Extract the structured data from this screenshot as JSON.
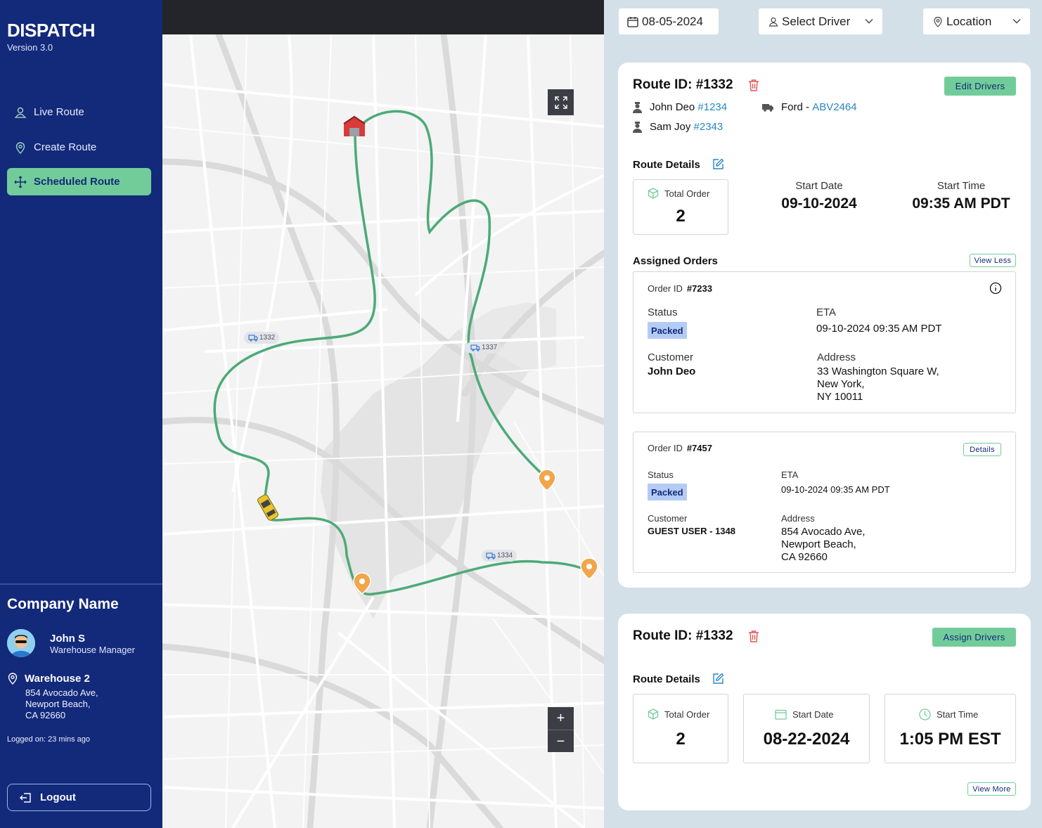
{
  "app": {
    "brand": "DISPATCH",
    "version": "Version 3.0"
  },
  "sidebar": {
    "items": [
      {
        "label": "Live Route",
        "icon": "person-pin-icon",
        "active": false
      },
      {
        "label": "Create Route",
        "icon": "location-pin-icon",
        "active": false
      },
      {
        "label": "Scheduled Route",
        "icon": "move-arrows-icon",
        "active": true
      }
    ],
    "company": "Company Name",
    "user": {
      "name": "John S",
      "role": "Warehouse  Manager"
    },
    "warehouse": {
      "name": "Warehouse 2",
      "address": [
        "854 Avocado Ave,",
        "Newport Beach,",
        "CA 92660"
      ]
    },
    "logged_on": "Logged on:  23 mins ago",
    "logout_label": "Logout"
  },
  "map": {
    "route_tags": [
      "1332",
      "1337",
      "1334"
    ],
    "zoom_in": "+",
    "zoom_out": "−"
  },
  "filters": {
    "date": "08-05-2024",
    "driver": "Select Driver",
    "location": "Location"
  },
  "routes": [
    {
      "route_id": "Route ID: #1332",
      "action_label": "Edit Drivers",
      "drivers": [
        {
          "name": "John Deo",
          "id": "#1234"
        },
        {
          "name": "Sam Joy",
          "id": "#2343"
        }
      ],
      "vehicle": {
        "make": "Ford - ",
        "plate": "ABV2464"
      },
      "details_title": "Route Details",
      "total_order_label": "Total Order",
      "total_order": "2",
      "start_date_label": "Start Date",
      "start_date": "09-10-2024",
      "start_time_label": "Start Time",
      "start_time": "09:35 AM PDT",
      "assigned_title": "Assigned Orders",
      "toggle_label": "View Less",
      "orders": [
        {
          "order_id_label": "Order ID",
          "order_id": "#7233",
          "status_label": "Status",
          "status": "Packed",
          "eta_label": "ETA",
          "eta": "09-10-2024 09:35 AM PDT",
          "customer_label": "Customer",
          "customer": "John Deo",
          "address_label": "Address",
          "address": [
            "33 Washington Square W,",
            "New York,",
            "NY 10011"
          ]
        },
        {
          "order_id_label": "Order ID",
          "order_id": "#7457",
          "details_label": "Details",
          "status_label": "Status",
          "status": "Packed",
          "eta_label": "ETA",
          "eta": "09-10-2024 09:35 AM PDT",
          "customer_label": "Customer",
          "customer": "GUEST USER - 1348",
          "address_label": "Address",
          "address": [
            "854 Avocado Ave,",
            "Newport Beach,",
            "CA 92660"
          ]
        }
      ]
    },
    {
      "route_id": "Route ID: #1332",
      "action_label": "Assign Drivers",
      "details_title": "Route Details",
      "total_order_label": "Total Order",
      "total_order": "2",
      "start_date_label": "Start Date",
      "start_date": "08-22-2024",
      "start_time_label": "Start Time",
      "start_time": "1:05 PM EST",
      "toggle_label": "View More"
    }
  ],
  "colors": {
    "sidebar": "#13297a",
    "accent": "#72cc9a",
    "route_line": "#4caa78",
    "pin": "#f2a54a",
    "link": "#2a86c4",
    "badge": "#b3ccf5"
  }
}
